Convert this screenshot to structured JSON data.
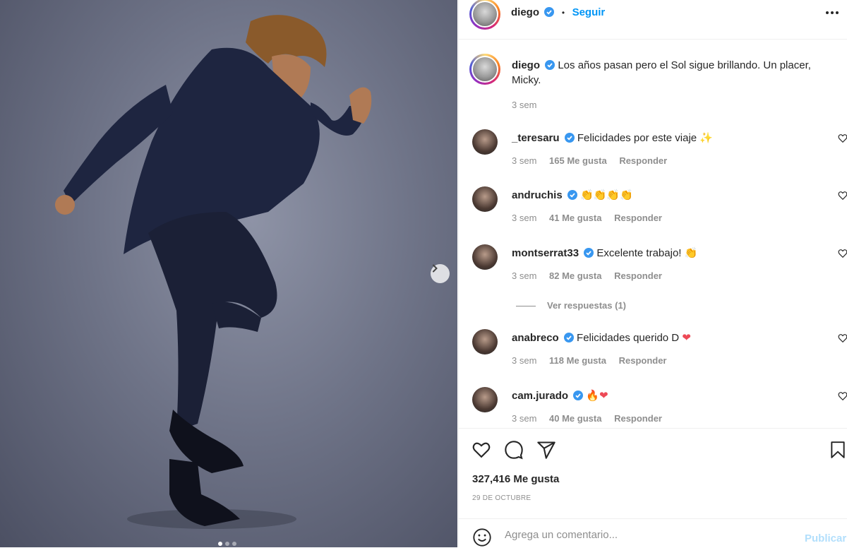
{
  "post": {
    "author": "diego",
    "follow_separator": "•",
    "follow_label": "Seguir",
    "caption": "Los años pasan pero el Sol sigue brillando. Un placer, Micky.",
    "caption_time": "3 sem",
    "carousel": {
      "slide_count": 3,
      "active_slide": 1
    }
  },
  "comments": [
    {
      "user": "_teresaru",
      "text": "Felicidades por este viaje",
      "emoji": "✨",
      "time": "3 sem",
      "likes": "165 Me gusta",
      "reply": "Responder"
    },
    {
      "user": "andruchis",
      "text": "",
      "emoji": "👏👏👏👏",
      "time": "3 sem",
      "likes": "41 Me gusta",
      "reply": "Responder"
    },
    {
      "user": "montserrat33",
      "text": "Excelente trabajo!",
      "emoji": "👏",
      "time": "3 sem",
      "likes": "82 Me gusta",
      "reply": "Responder",
      "view_replies": "Ver respuestas (1)"
    },
    {
      "user": "anabreco",
      "text": "Felicidades querido D",
      "emoji": "❤",
      "time": "3 sem",
      "likes": "118 Me gusta",
      "reply": "Responder"
    },
    {
      "user": "cam.jurado",
      "text": "",
      "emoji": "🔥❤",
      "time": "3 sem",
      "likes": "40 Me gusta",
      "reply": "Responder"
    }
  ],
  "engagement": {
    "likes": "327,416 Me gusta",
    "date": "29 DE OCTUBRE"
  },
  "comment_input": {
    "placeholder": "Agrega un comentario...",
    "publish_label": "Publicar"
  },
  "colors": {
    "link_blue": "#0095f6",
    "verified_blue": "#3897f0",
    "publish_disabled": "#b2dffc",
    "heart_red": "#ed4956"
  }
}
